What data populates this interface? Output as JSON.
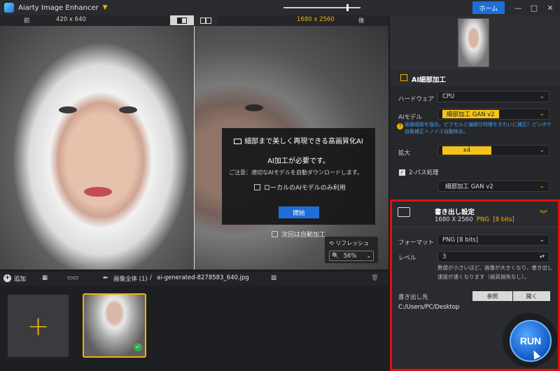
{
  "app": {
    "title": "Aiarty Image Enhancer",
    "home_label": "ホーム",
    "minimize": "—",
    "maximize": "□",
    "close": "✕",
    "accent": "#f0b400",
    "primary_blue": "#1f6ed8",
    "highlight_red": "#e01010"
  },
  "compare": {
    "before_label": "前",
    "before_res": "420 x 640",
    "after_res": "1680 x 2560",
    "after_label": "後"
  },
  "ai_dialog": {
    "title": "細部まで美しく再現できる高画質化AI",
    "required": "AI加工が必要です。",
    "note": "ご注意：適切なAIモデルを自動ダウンロードします。",
    "local_only": "ローカルのAIモデルのみ利用",
    "start": "開始"
  },
  "auto_next": "次回は自動加工",
  "refresh_label": "リフレッシュ",
  "zoom_value": "56%",
  "toolbar": {
    "add_label": "追加",
    "all_images": "画像全体 (1)",
    "separator": "/",
    "file_name": "ai-generated-8278583_640.jpg"
  },
  "enhance": {
    "section_title": "AI細部加工",
    "hardware_label": "ハードウェア",
    "hardware_value": "CPU",
    "model_label": "AIモデル",
    "model_value": "細部加工 GAN v2",
    "hint": "画像細部を強化、ピクセルと繊細な特徴をきれいに補正！ピンボケ自動補正＋ノイズ自動除去。",
    "scale_label": "拡大",
    "scale_value": "x4",
    "two_pass_label": "2-パス処理",
    "two_pass_model": "細部加工 GAN v2"
  },
  "export": {
    "title": "書き出し設定",
    "size": "1680 X 2560",
    "format_short": "PNG",
    "bits": "[8 bits]",
    "format_label": "フォーマット",
    "format_value": "PNG   [8 bits]",
    "level_label": "レベル",
    "level_value": "3",
    "level_note": "数値が小さいほど、画像が大きくなり、書き出し速度が速くなります（画質損失なし）。",
    "dest_label": "書き出し先",
    "browse": "参照",
    "open": "開く",
    "path": "C:/Users/PC/Desktop",
    "run": "RUN"
  }
}
